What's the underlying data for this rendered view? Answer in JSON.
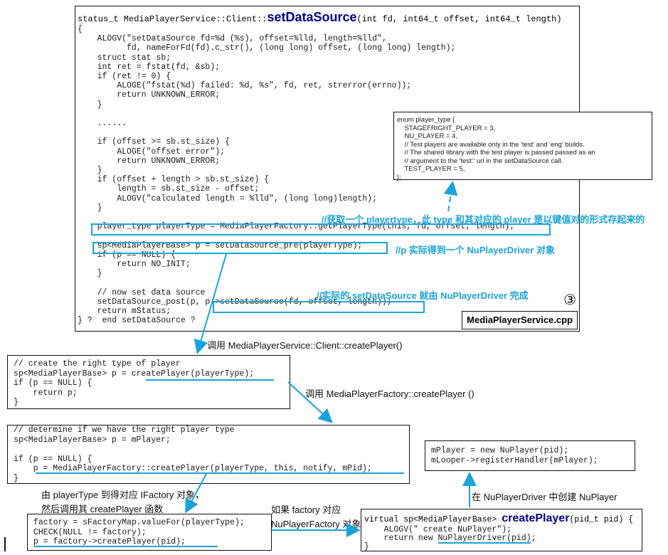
{
  "main_box": {
    "signature_prefix": "status_t MediaPlayerService::Client::",
    "signature_func": "setDataSource",
    "signature_args": "(int fd, int64_t offset, int64_t length)",
    "lines": [
      "{",
      "    ALOGV(\"setDataSource fd=%d (%s), offset=%lld, length=%lld\",",
      "          fd, nameForFd(fd).c_str(), (long long) offset, (long long) length);",
      "    struct stat sb;",
      "    int ret = fstat(fd, &sb);",
      "    if (ret != 0) {",
      "        ALOGE(\"fstat(%d) failed: %d, %s\", fd, ret, strerror(errno));",
      "        return UNKNOWN_ERROR;",
      "    }",
      "",
      "    ......",
      "",
      "    if (offset >= sb.st_size) {",
      "        ALOGE(\"offset error\");",
      "        return UNKNOWN_ERROR;",
      "    }",
      "    if (offset + length > sb.st_size) {",
      "        length = sb.st_size - offset;",
      "        ALOGV(\"calculated length = %lld\", (long long)length);",
      "    }",
      "",
      "    player_type playerType = MediaPlayerFactory::getPlayerType(this, fd, offset, length);",
      "",
      "    sp<MediaPlayerBase> p = setDataSource_pre(playerType);",
      "    if (p == NULL) {",
      "        return NO_INIT;",
      "    }",
      "",
      "    // now set data source",
      "    setDataSource_post(p, p->setDataSource(fd, offset, length));",
      "    return mStatus;",
      "} ?  end setDataSource ?"
    ],
    "circle_number": "③",
    "file_label": "MediaPlayerService.cpp"
  },
  "enum_box": {
    "lines": [
      "enum player_type {",
      "    STAGEFRIGHT_PLAYER = 3,",
      "    NU_PLAYER = 4,",
      "    // Test players are available only in the 'test' and 'eng' builds.",
      "    // The shared library with the test player is passed passed as an",
      "    // argument to the 'test:' url in the setDataSource call.",
      "    TEST_PLAYER = 5,",
      "};"
    ]
  },
  "annotations": {
    "a1": "//获取一个 playertype，此 type 和其对应的 player 是以键值对的形式存起来的",
    "a2": "//p 实际得到一个 NuPlayerDriver 对象",
    "a3": "//实际的 setDataSource 就由 NuPlayerDriver 完成",
    "a4": "调用 MediaPlayerService::Client::createPlayer()",
    "a5": "调用 MediaPlayerFactory::createPlayer ()",
    "a6": "由 playerType 到得对应 IFactory 对象，",
    "a7": "然后调用其 createPlayer 函数",
    "a8": "如果 factory 对应",
    "a9": "NuPlayerFactory 对象",
    "a10": "在 NuPlayerDriver 中创建 NuPlayer"
  },
  "box2": {
    "lines": [
      "// create the right type of player",
      "sp<MediaPlayerBase> p = createPlayer(playerType);",
      "if (p == NULL) {",
      "    return p;",
      "}"
    ]
  },
  "box3": {
    "lines": [
      "// determine if we have the right player type",
      "sp<MediaPlayerBase> p = mPlayer;",
      "",
      "if (p == NULL) {",
      "    p = MediaPlayerFactory::createPlayer(playerType, this, notify, mPid);",
      "}"
    ]
  },
  "box4": {
    "lines": [
      "factory = sFactoryMap.valueFor(playerType);",
      "CHECK(NULL != factory);",
      "p = factory->createPlayer(pid);"
    ]
  },
  "box5": {
    "sig_prefix": "virtual sp<MediaPlayerBase> ",
    "sig_func": "createPlayer",
    "sig_args": "(pid_t pid) {",
    "lines": [
      "    ALOGV(\" create NuPlayer\");",
      "    return new NuPlayerDriver(pid);",
      "}"
    ]
  },
  "box6": {
    "lines": [
      "mPlayer = new NuPlayer(pid);",
      "mLooper->registerHandler(mPlayer);"
    ]
  },
  "colors": {
    "accent": "#1aa3d9",
    "keyword": "#7f0000",
    "function": "#00008b",
    "comment": "#0055cc",
    "string_highlight": "#ffff99"
  }
}
